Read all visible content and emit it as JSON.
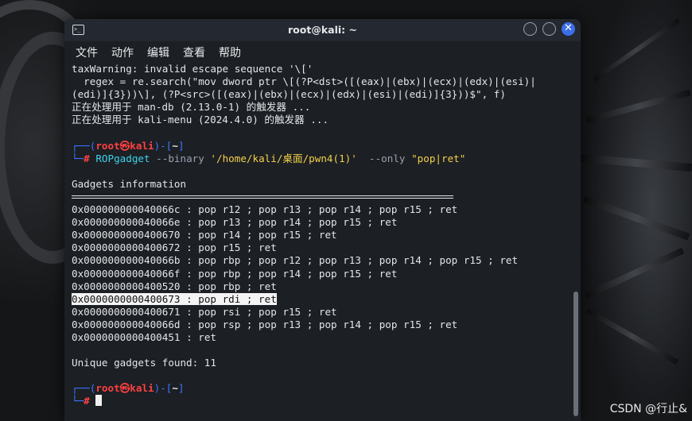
{
  "window": {
    "title": "root@kali: ~",
    "terminal_icon": "terminal-icon",
    "controls": [
      "minimize-button",
      "maximize-button",
      "close-button"
    ]
  },
  "menu": [
    "文件",
    "动作",
    "编辑",
    "查看",
    "帮助"
  ],
  "output_top": [
    "taxWarning: invalid escape sequence '\\['",
    "  regex = re.search(\"mov dword ptr \\[(?P<dst>([(eax)|(ebx)|(ecx)|(edx)|(esi)|",
    "(edi)]{3}))\\], (?P<src>([(eax)|(ebx)|(ecx)|(edx)|(esi)|(edi)]{3}))$\", f)",
    "正在处理用于 man-db (2.13.0-1) 的触发器 ...",
    "正在处理用于 kali-menu (2024.4.0) 的触发器 ..."
  ],
  "prompt": {
    "corner_top": "┌──(",
    "user": "root㉿kali",
    "mid": ")-[",
    "dir": "~",
    "end": "]",
    "corner_bottom": "└─",
    "hash": "# "
  },
  "command": {
    "program": "ROPgadget",
    "flag_binary": " --binary ",
    "binary_path": "'/home/kali/桌面/pwn4(1)'",
    "flag_only": "  --only ",
    "only_value": "\"pop|ret\""
  },
  "gadgets_header": "Gadgets information",
  "gadgets": [
    {
      "addr": "0x000000000040066c",
      "instr": "pop r12 ; pop r13 ; pop r14 ; pop r15 ; ret",
      "highlighted": false
    },
    {
      "addr": "0x000000000040066e",
      "instr": "pop r13 ; pop r14 ; pop r15 ; ret",
      "highlighted": false
    },
    {
      "addr": "0x0000000000400670",
      "instr": "pop r14 ; pop r15 ; ret",
      "highlighted": false
    },
    {
      "addr": "0x0000000000400672",
      "instr": "pop r15 ; ret",
      "highlighted": false
    },
    {
      "addr": "0x000000000040066b",
      "instr": "pop rbp ; pop r12 ; pop r13 ; pop r14 ; pop r15 ; ret",
      "highlighted": false
    },
    {
      "addr": "0x000000000040066f",
      "instr": "pop rbp ; pop r14 ; pop r15 ; ret",
      "highlighted": false
    },
    {
      "addr": "0x0000000000400520",
      "instr": "pop rbp ; ret",
      "highlighted": false
    },
    {
      "addr": "0x0000000000400673",
      "instr": "pop rdi ; ret",
      "highlighted": true
    },
    {
      "addr": "0x0000000000400671",
      "instr": "pop rsi ; pop r15 ; ret",
      "highlighted": false
    },
    {
      "addr": "0x000000000040066d",
      "instr": "pop rsp ; pop r13 ; pop r14 ; pop r15 ; ret",
      "highlighted": false
    },
    {
      "addr": "0x0000000000400451",
      "instr": "ret",
      "highlighted": false
    }
  ],
  "unique_label": "Unique gadgets found: 11",
  "watermark": "CSDN @行止&",
  "colors": {
    "prompt_blue": "#3b78ff",
    "prompt_red": "#ff4040",
    "command_cyan": "#3bd4e8",
    "string_yellow": "#f2d14a",
    "close_button_blue": "#3b6ee8"
  }
}
